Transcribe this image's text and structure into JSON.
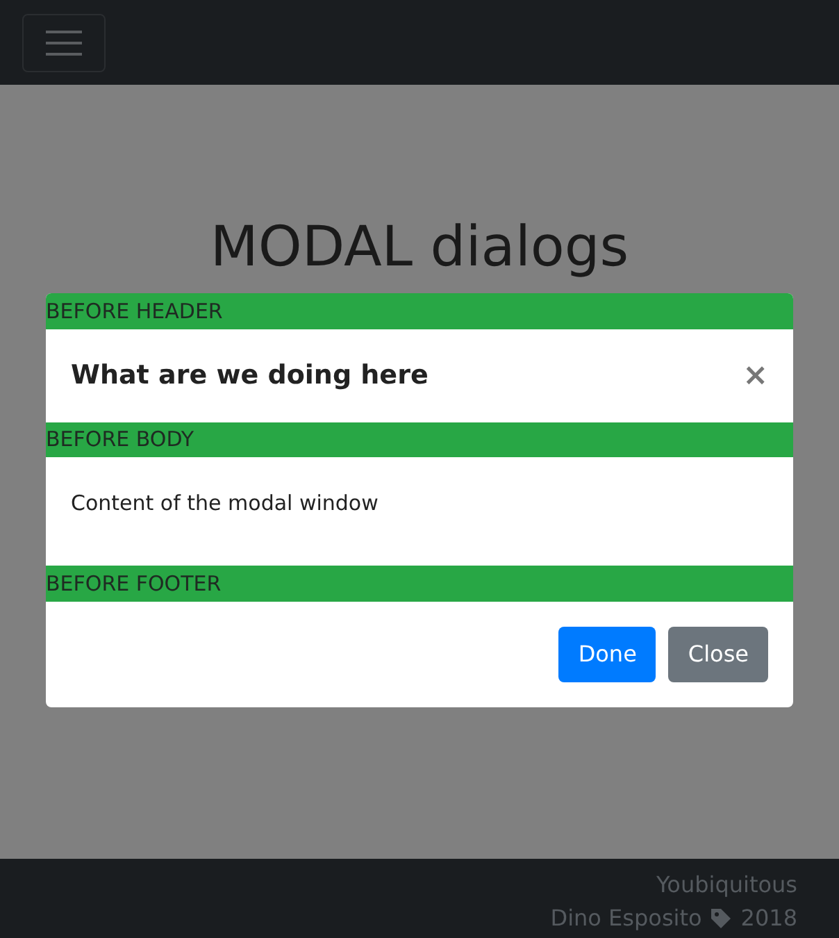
{
  "page": {
    "heading": "MODAL dialogs"
  },
  "modal": {
    "title": "What are we doing here",
    "close": "×",
    "body": "Content of the modal window",
    "markers": [
      "BEFORE HEADER",
      "BEFORE BODY",
      "BEFORE FOOTER"
    ],
    "buttons": [
      {
        "label": "Done",
        "kind": "primary"
      },
      {
        "label": "Close",
        "kind": "secondary"
      }
    ]
  },
  "footer": {
    "brand": "Youbiquitous",
    "author": "Dino Esposito",
    "year": "2018"
  }
}
